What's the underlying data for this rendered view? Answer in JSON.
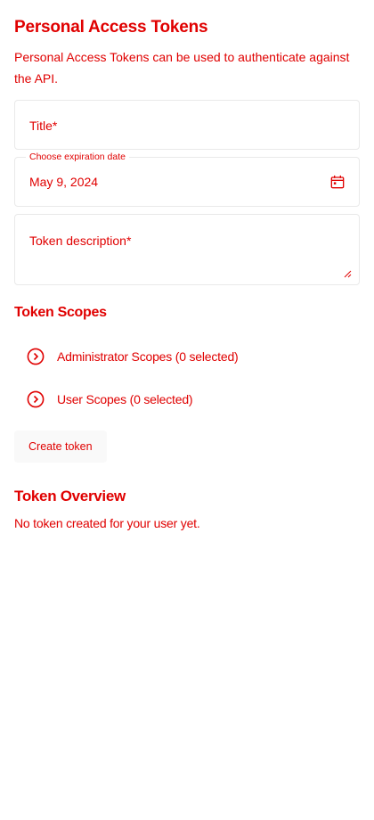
{
  "page": {
    "title": "Personal Access Tokens",
    "intro": "Personal Access Tokens can be used to authenticate against the API."
  },
  "form": {
    "title_placeholder": "Title*",
    "expiry": {
      "label": "Choose expiration date",
      "value": "May 9, 2024",
      "icon": "calendar-icon"
    },
    "description_placeholder": "Token description*"
  },
  "scopes": {
    "title": "Token Scopes",
    "items": [
      {
        "label": "Administrator Scopes (0 selected)",
        "icon": "chevron-right-circle-icon"
      },
      {
        "label": "User Scopes (0 selected)",
        "icon": "chevron-right-circle-icon"
      }
    ]
  },
  "actions": {
    "create_label": "Create token"
  },
  "overview": {
    "title": "Token Overview",
    "empty_text": "No token created for your user yet."
  },
  "colors": {
    "text": "#e00000",
    "border": "#e9e9e9",
    "button_bg": "#f9f9f9",
    "background": "#ffffff"
  }
}
